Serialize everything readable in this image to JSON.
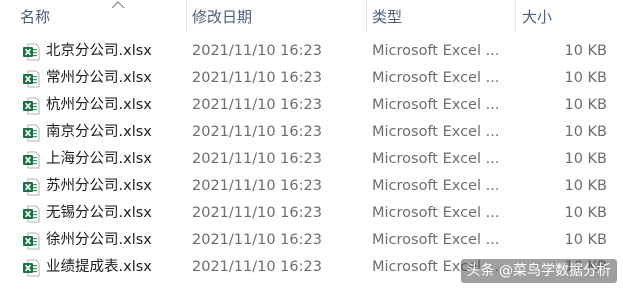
{
  "columns": {
    "name": "名称",
    "date": "修改日期",
    "type": "类型",
    "size": "大小"
  },
  "files": [
    {
      "name": "北京分公司.xlsx",
      "date": "2021/11/10 16:23",
      "type": "Microsoft Excel ...",
      "size": "10 KB"
    },
    {
      "name": "常州分公司.xlsx",
      "date": "2021/11/10 16:23",
      "type": "Microsoft Excel ...",
      "size": "10 KB"
    },
    {
      "name": "杭州分公司.xlsx",
      "date": "2021/11/10 16:23",
      "type": "Microsoft Excel ...",
      "size": "10 KB"
    },
    {
      "name": "南京分公司.xlsx",
      "date": "2021/11/10 16:23",
      "type": "Microsoft Excel ...",
      "size": "10 KB"
    },
    {
      "name": "上海分公司.xlsx",
      "date": "2021/11/10 16:23",
      "type": "Microsoft Excel ...",
      "size": "10 KB"
    },
    {
      "name": "苏州分公司.xlsx",
      "date": "2021/11/10 16:23",
      "type": "Microsoft Excel ...",
      "size": "10 KB"
    },
    {
      "name": "无锡分公司.xlsx",
      "date": "2021/11/10 16:23",
      "type": "Microsoft Excel ...",
      "size": "10 KB"
    },
    {
      "name": "徐州分公司.xlsx",
      "date": "2021/11/10 16:23",
      "type": "Microsoft Excel ...",
      "size": "10 KB"
    },
    {
      "name": "业绩提成表.xlsx",
      "date": "2021/11/10 16:23",
      "type": "Microsoft Excel ...",
      "size": "10 KB"
    }
  ],
  "watermark": "头条 @菜鸟学数据分析",
  "colors": {
    "header_text": "#4c607a",
    "excel_green": "#1d7044"
  },
  "icons": {
    "sort": "chevron-up-icon",
    "file": "excel-file-icon"
  }
}
